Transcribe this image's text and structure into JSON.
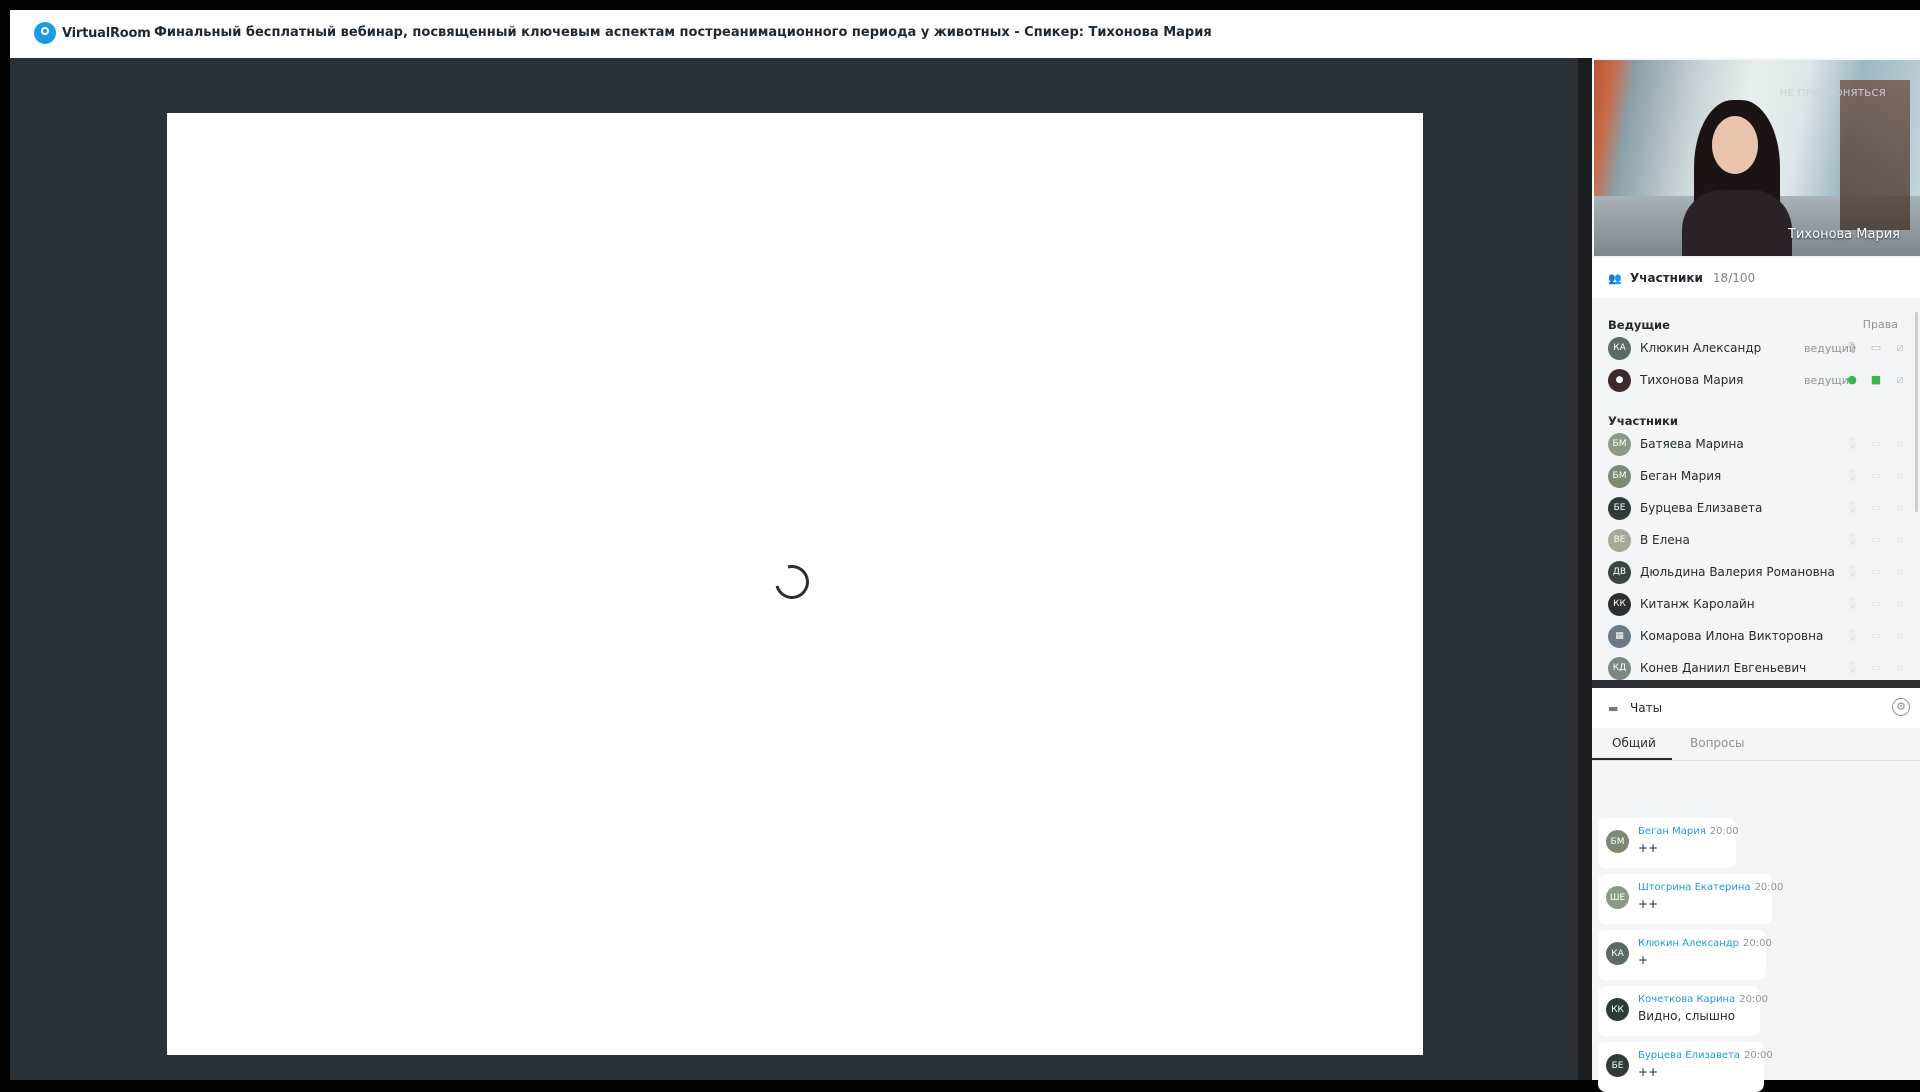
{
  "header": {
    "logo_text": "VirtualRoom",
    "title": "Финальный бесплатный вебинар, посвященный ключевым аспектам постреанимационного периода у животных - Спикер: Тихонова Мария"
  },
  "video": {
    "speaker_name": "Тихонова Мария",
    "background_sign": "НЕ ПРИСЛОНЯТЬСЯ"
  },
  "participants": {
    "title": "Участники",
    "count": "18/100",
    "hosts_label": "Ведущие",
    "rights_label": "Права",
    "hosts": [
      {
        "initials": "КА",
        "name": "Клюкин Александр",
        "role": "ведущий",
        "color": "#5a6a66"
      },
      {
        "initials": "",
        "name": "Тихонова Мария",
        "role": "ведущий",
        "color": "#3a2a2a"
      }
    ],
    "members_label": "Участники",
    "members": [
      {
        "initials": "БМ",
        "name": "Батяева Марина",
        "color": "#8a9a86"
      },
      {
        "initials": "БМ",
        "name": "Беган Мария",
        "color": "#7d8a72"
      },
      {
        "initials": "БЕ",
        "name": "Бурцева Елизавета",
        "color": "#2f3a3a"
      },
      {
        "initials": "ВЕ",
        "name": "В Елена",
        "color": "#a3aa96"
      },
      {
        "initials": "ДВ",
        "name": "Дюльдина Валерия Романовна",
        "color": "#3a4540"
      },
      {
        "initials": "КК",
        "name": "Китанж Каролайн",
        "color": "#2a302f"
      },
      {
        "initials": "",
        "name": "Комарова Илона Викторовна",
        "color": "#6c7a86"
      },
      {
        "initials": "КД",
        "name": "Конев Даниил Евгеньевич",
        "color": "#7a8a82"
      }
    ]
  },
  "chat": {
    "title": "Чаты",
    "tabs": [
      "Общий",
      "Вопросы"
    ],
    "messages": [
      {
        "initials": "БМ",
        "author": "Беган Мария",
        "time": "20:00",
        "text": "++",
        "color": "#7d8a72"
      },
      {
        "initials": "ШЕ",
        "author": "Штогрина Екатерина",
        "time": "20:00",
        "text": "++",
        "color": "#8a9a86"
      },
      {
        "initials": "КА",
        "author": "Клюкин Александр",
        "time": "20:00",
        "text": "+",
        "color": "#5a6a66"
      },
      {
        "initials": "КК",
        "author": "Кочеткова Карина",
        "time": "20:00",
        "text": "Видно, слышно",
        "color": "#2f3a3a"
      },
      {
        "initials": "БЕ",
        "author": "Бурцева Елизавета",
        "time": "20:00",
        "text": "++",
        "color": "#2f3a3a"
      }
    ]
  }
}
